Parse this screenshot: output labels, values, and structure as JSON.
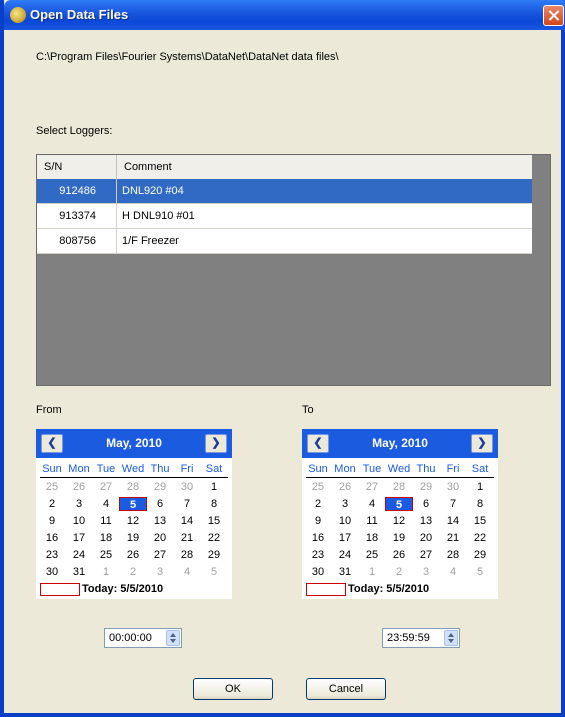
{
  "window": {
    "title": "Open Data Files"
  },
  "path": "C:\\Program Files\\Fourier Systems\\DataNet\\DataNet data files\\",
  "select_label": "Select Loggers:",
  "table": {
    "columns": [
      "S/N",
      "Comment"
    ],
    "rows": [
      {
        "sn": "912486",
        "comment": "DNL920 #04",
        "selected": true
      },
      {
        "sn": "913374",
        "comment": "H DNL910 #01",
        "selected": false
      },
      {
        "sn": "808756",
        "comment": "1/F Freezer",
        "selected": false
      }
    ]
  },
  "from": {
    "label": "From",
    "month": "May, 2010",
    "today": "Today: 5/5/2010",
    "time": "00:00:00"
  },
  "to": {
    "label": "To",
    "month": "May, 2010",
    "today": "Today: 5/5/2010",
    "time": "23:59:59"
  },
  "calendar": {
    "days_of_week": [
      "Sun",
      "Mon",
      "Tue",
      "Wed",
      "Thu",
      "Fri",
      "Sat"
    ],
    "weeks": [
      [
        "25",
        "26",
        "27",
        "28",
        "29",
        "30",
        "1"
      ],
      [
        "2",
        "3",
        "4",
        "5",
        "6",
        "7",
        "8"
      ],
      [
        "9",
        "10",
        "11",
        "12",
        "13",
        "14",
        "15"
      ],
      [
        "16",
        "17",
        "18",
        "19",
        "20",
        "21",
        "22"
      ],
      [
        "23",
        "24",
        "25",
        "26",
        "27",
        "28",
        "29"
      ],
      [
        "30",
        "31",
        "1",
        "2",
        "3",
        "4",
        "5"
      ]
    ],
    "selected_day": "5"
  },
  "buttons": {
    "ok": "OK",
    "cancel": "Cancel"
  },
  "colors": {
    "titlebar": "#1a58e0",
    "calendar_header": "#1a5be0",
    "selection": "#316ac5",
    "today_border": "#cc0000"
  }
}
